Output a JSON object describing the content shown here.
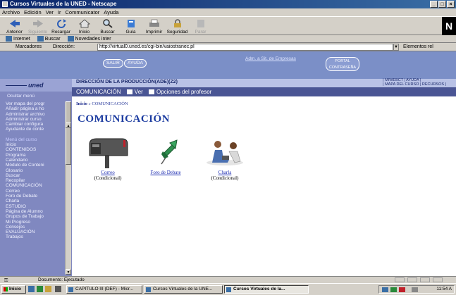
{
  "window": {
    "title": "Cursos Virtuales de la UNED - Netscape",
    "buttons": [
      "_",
      "□",
      "×"
    ]
  },
  "menubar": [
    "Archivo",
    "Edición",
    "Ver",
    "Ir",
    "Communicator",
    "Ayuda"
  ],
  "toolbar": {
    "buttons": [
      {
        "label": "Anterior",
        "icon": "back-arrow-icon",
        "enabled": true
      },
      {
        "label": "Siguiente",
        "icon": "forward-arrow-icon",
        "enabled": false
      },
      {
        "label": "Recargar",
        "icon": "reload-icon",
        "enabled": true
      },
      {
        "label": "Inicio",
        "icon": "home-icon",
        "enabled": true
      },
      {
        "label": "Buscar",
        "icon": "search-icon",
        "enabled": true
      },
      {
        "label": "Guía",
        "icon": "guide-icon",
        "enabled": true
      },
      {
        "label": "Imprimir",
        "icon": "print-icon",
        "enabled": true
      },
      {
        "label": "Seguridad",
        "icon": "security-icon",
        "enabled": true
      },
      {
        "label": "Parar",
        "icon": "stop-icon",
        "enabled": false
      }
    ],
    "logo": "N"
  },
  "personal_toolbar": [
    "Internet",
    "Buscar",
    "Novedades inter"
  ],
  "location": {
    "bookmarks_label": "Marcadores",
    "address_label": "Dirección:",
    "url": "http://virtual0.uned.es/cgi-bin/vaiostranec.pl",
    "related": "Elementos rel"
  },
  "site_header": {
    "salir": "SALIR",
    "ayuda": "AYUDA",
    "admin_link": "Adm. a Sit. de Empresas",
    "portal_line1": "PORTAL",
    "portal_line2": "CONTRASEÑA"
  },
  "sidebar": {
    "logo": "uned",
    "hide_menu": "Ocultar menú",
    "items": [
      "Ver mapa del progr",
      "Añadir página a ho",
      "Administrar archivo",
      "Administrar curso",
      "Cambiar configura",
      "Ayudante de conte",
      "",
      "Menú del curso",
      "Inicio",
      "CONTENIDOS",
      "Programa",
      "Calendario",
      "Módulo de Conteni",
      "Glosario",
      "Buscar",
      "Recopilar",
      "COMUNICACIÓN",
      "Correo",
      "Foro de Debate",
      "Charla",
      "ESTUDIO",
      "Página de Alumno",
      "Grupos de Trabajo",
      "Mi Progreso",
      "Consejos",
      "EVALUACIÓN",
      "Trabajos"
    ]
  },
  "course": {
    "title": "DIRECCIÓN DE LA PRODUCCIÓN(ADE)(Z2)",
    "links_line1": "| MIWEBCT | AYUDA |",
    "links_line2": "| MAPA DEL CURSO | RECURSOS |"
  },
  "communication_bar": {
    "section": "COMUNICACIÓN",
    "view": "Ver",
    "teacher_options": "Opciones del profesor"
  },
  "main": {
    "breadcrumb_home": "Inicio",
    "breadcrumb_sep": "»",
    "breadcrumb_current": "COMUNICACIÓN",
    "page_title": "COMUNICACIÓN",
    "tools": [
      {
        "label": "Correo",
        "note": "(Condicional)",
        "icon": "mailbox-icon"
      },
      {
        "label": "Foro de Debate",
        "note": "",
        "icon": "pushpin-icon"
      },
      {
        "label": "Charla",
        "note": "(Condicional)",
        "icon": "chat-people-icon"
      }
    ]
  },
  "statusbar": {
    "text": "Documento: Ejecutado"
  },
  "taskbar": {
    "start": "Inicio",
    "tasks": [
      "CAPITULO III (DEF) - Micr...",
      "Cursos Virtuales de la UNE...",
      "Cursos Virtuales de la..."
    ],
    "clock": "11:54 A"
  }
}
